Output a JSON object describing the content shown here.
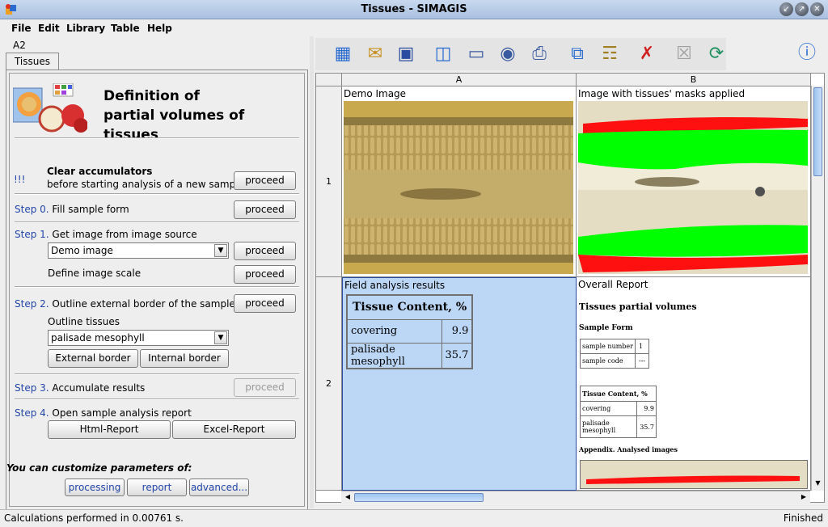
{
  "window": {
    "title": "Tissues - SIMAGIS"
  },
  "menu": [
    "File",
    "Edit",
    "Library",
    "Table",
    "Help"
  ],
  "left": {
    "cell_ref": "A2",
    "tab_label": "Tissues",
    "header_line1": "Definition of",
    "header_line2": "partial volumes of tissues",
    "clear": {
      "marker": "!!!",
      "title": "Clear accumulators",
      "subtitle": "before starting analysis of a new sample"
    },
    "step0": {
      "step": "Step 0.",
      "text": "Fill sample form"
    },
    "step1": {
      "step": "Step 1.",
      "text": "Get image from image source",
      "source_value": "Demo image",
      "scale_text": "Define image scale"
    },
    "step2": {
      "step": "Step 2.",
      "text": "Outline external border of the sample",
      "outline_label": "Outline tissues",
      "tissue_value": "palisade mesophyll",
      "external_btn": "External border",
      "internal_btn": "Internal border"
    },
    "step3": {
      "step": "Step 3.",
      "text": "Accumulate results"
    },
    "step4": {
      "step": "Step 4.",
      "text": "Open sample analysis report",
      "html_btn": "Html-Report",
      "excel_btn": "Excel-Report"
    },
    "proceed": "proceed",
    "customize": {
      "text": "You can customize parameters of:",
      "processing": "processing",
      "report": "report",
      "advanced": "advanced..."
    }
  },
  "grid": {
    "col_a": "A",
    "col_b": "B",
    "row_1": "1",
    "row_2": "2",
    "a1_title": "Demo Image",
    "b1_title": "Image with tissues' masks applied",
    "a2_title": "Field analysis results",
    "b2_title": "Overall Report",
    "content_header": "Tissue Content, %",
    "rows": [
      {
        "name": "covering",
        "value": "9.9"
      },
      {
        "name": "palisade mesophyll",
        "value": "35.7"
      }
    ],
    "report": {
      "title": "Tissues partial volumes",
      "sample_form_title": "Sample Form",
      "sample_number_label": "sample number",
      "sample_number_value": "1",
      "sample_code_label": "sample code",
      "sample_code_value": "---",
      "content_header": "Tissue Content, %",
      "appendix": "Appendix. Analysed images"
    }
  },
  "status": {
    "left": "Calculations performed in 0.00761 s.",
    "right": "Finished"
  },
  "colors": {
    "selected_cell": "#bcd6f5",
    "mask_green": "#00ff00",
    "mask_red": "#ff1010",
    "step_blue": "#2346a8"
  }
}
